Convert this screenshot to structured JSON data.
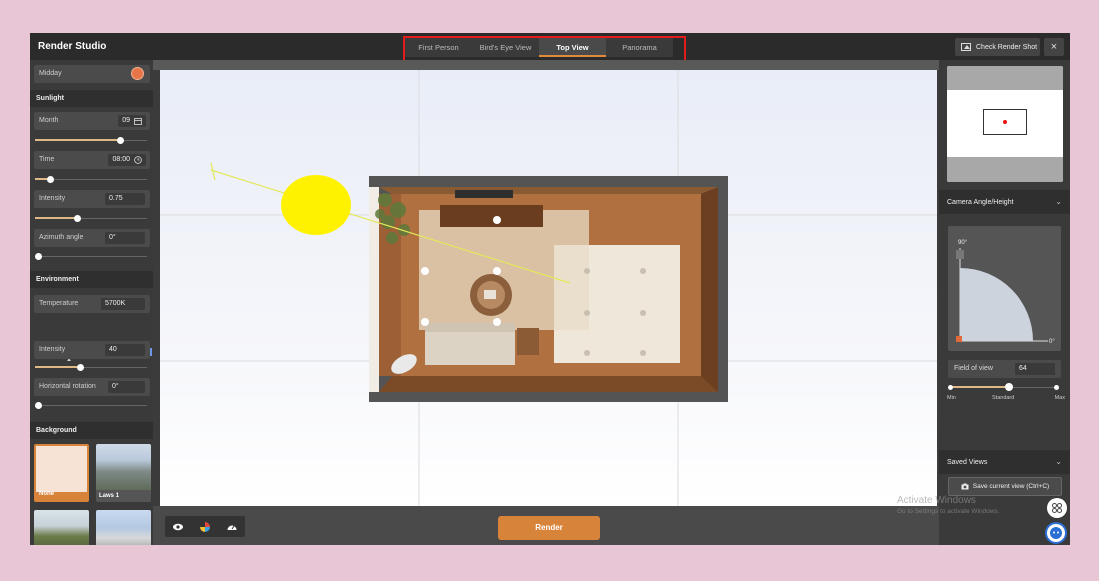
{
  "app": {
    "title": "Render Studio"
  },
  "view_tabs": [
    {
      "label": "First Person",
      "active": false
    },
    {
      "label": "Bird's Eye View",
      "active": false
    },
    {
      "label": "Top View",
      "active": true
    },
    {
      "label": "Panorama",
      "active": false
    }
  ],
  "topbar": {
    "check_render_label": "Check Render Shot",
    "close_icon": "×"
  },
  "left": {
    "preset": {
      "label": "Midday",
      "color": "#e8744a"
    },
    "sunlight": {
      "title": "Sunlight",
      "month": {
        "label": "Month",
        "value": "09",
        "slider": 0.76
      },
      "time": {
        "label": "Time",
        "value": "08:00",
        "slider": 0.13
      },
      "intensity": {
        "label": "Intensity",
        "value": "0.75",
        "slider": 0.37
      },
      "azimuth": {
        "label": "Azimuth angle",
        "value": "0°",
        "slider": 0.0
      }
    },
    "environment": {
      "title": "Environment",
      "temperature": {
        "label": "Temperature",
        "value": "5700K"
      },
      "intensity": {
        "label": "Intensity",
        "value": "40",
        "slider": 0.4
      },
      "rotation": {
        "label": "Horizontal rotation",
        "value": "0°",
        "slider": 0.0
      }
    },
    "background": {
      "title": "Background",
      "items": [
        {
          "caption": "None",
          "selected": true
        },
        {
          "caption": "Laws 1",
          "selected": false
        }
      ]
    }
  },
  "right": {
    "camera_section": "Camera Angle/Height",
    "angle_top": "90°",
    "angle_bottom": "0°",
    "fov": {
      "label": "Field of view",
      "value": "64",
      "slider": 0.55
    },
    "fov_labels": {
      "min": "Min",
      "standard": "Standard",
      "max": "Max"
    },
    "saved_views_section": "Saved Views",
    "save_button": "Save current view (Ctrl+C)"
  },
  "bottom": {
    "render_label": "Render"
  },
  "watermark": {
    "line1": "Activate Windows",
    "line2": "Go to Settings to activate Windows."
  }
}
